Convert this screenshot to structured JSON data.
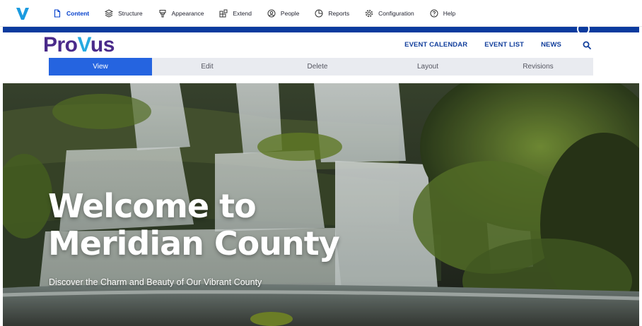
{
  "admin_toolbar": {
    "items": [
      {
        "label": "Content",
        "icon": "file-icon",
        "active": true
      },
      {
        "label": "Structure",
        "icon": "layers-icon"
      },
      {
        "label": "Appearance",
        "icon": "brush-icon"
      },
      {
        "label": "Extend",
        "icon": "puzzle-icon"
      },
      {
        "label": "People",
        "icon": "user-icon"
      },
      {
        "label": "Reports",
        "icon": "chart-pie-icon"
      },
      {
        "label": "Configuration",
        "icon": "gear-icon"
      },
      {
        "label": "Help",
        "icon": "help-icon"
      }
    ],
    "accent": "#003ecc"
  },
  "site": {
    "logo_part1": "Pro",
    "logo_part2": "V",
    "logo_part3": "us",
    "nav": [
      "EVENT CALENDAR",
      "EVENT LIST",
      "NEWS"
    ],
    "brand_color": "#4a2a8a",
    "nav_color": "#123f9c"
  },
  "tabs": [
    "View",
    "Edit",
    "Delete",
    "Layout",
    "Revisions"
  ],
  "hero": {
    "title_line1": "Welcome to",
    "title_line2": "Meridian County",
    "subtitle": "Discover the Charm and Beauty of Our Vibrant County"
  }
}
